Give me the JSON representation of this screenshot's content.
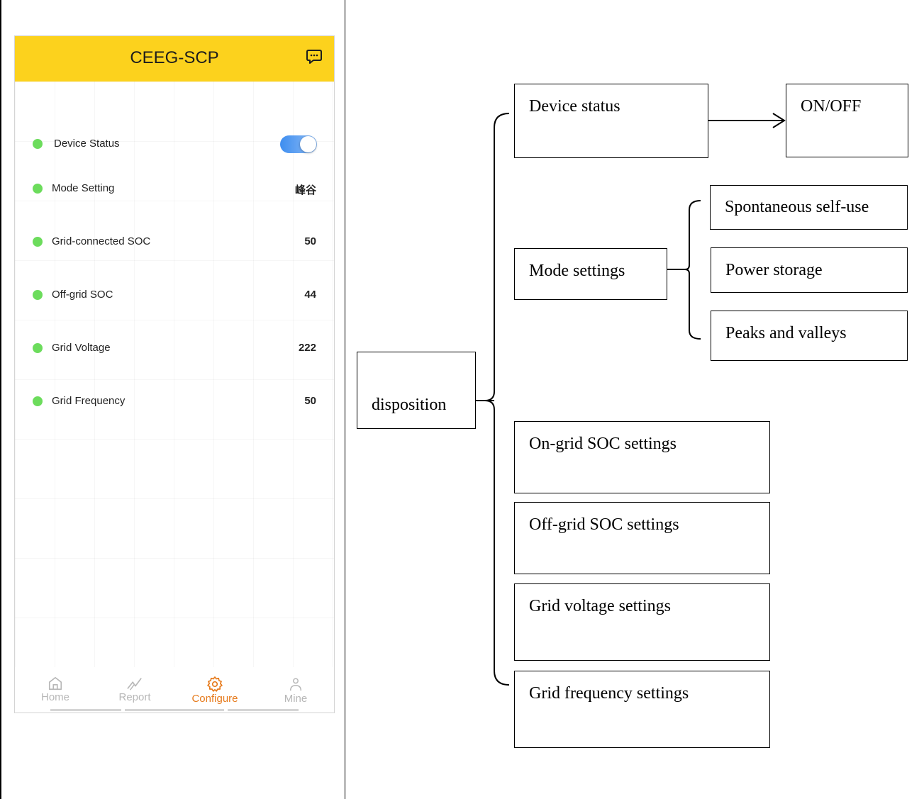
{
  "app": {
    "title": "CEEG-SCP",
    "header_icon": "chat-bubble-icon",
    "colors": {
      "header": "#fcd21d",
      "status_dot": "#6cdc5c",
      "toggle_on": "#3e8ef0",
      "active_tab": "#e67a1b"
    }
  },
  "settings": {
    "device_status": {
      "label": "Device Status",
      "state": "on"
    },
    "rows": [
      {
        "label": "Mode Setting",
        "value": "峰谷"
      },
      {
        "label": "Grid-connected SOC",
        "value": "50"
      },
      {
        "label": "Off-grid SOC",
        "value": "44"
      },
      {
        "label": "Grid Voltage",
        "value": "222"
      },
      {
        "label": "Grid Frequency",
        "value": "50"
      }
    ]
  },
  "tabbar": {
    "tabs": [
      {
        "label": "Home",
        "icon": "home-icon",
        "active": false
      },
      {
        "label": "Report",
        "icon": "report-icon",
        "active": false
      },
      {
        "label": "Configure",
        "icon": "gear-icon",
        "active": true
      },
      {
        "label": "Mine",
        "icon": "user-icon",
        "active": false
      }
    ]
  },
  "diagram": {
    "root": "disposition",
    "device_status": "Device status",
    "on_off": "ON/OFF",
    "mode_settings": "Mode settings",
    "modes": [
      "Spontaneous self-use",
      "Power storage",
      "Peaks and valleys"
    ],
    "on_grid_soc": "On-grid SOC settings",
    "off_grid_soc": "Off-grid SOC settings",
    "grid_voltage": "Grid voltage settings",
    "grid_frequency": "Grid frequency settings"
  }
}
